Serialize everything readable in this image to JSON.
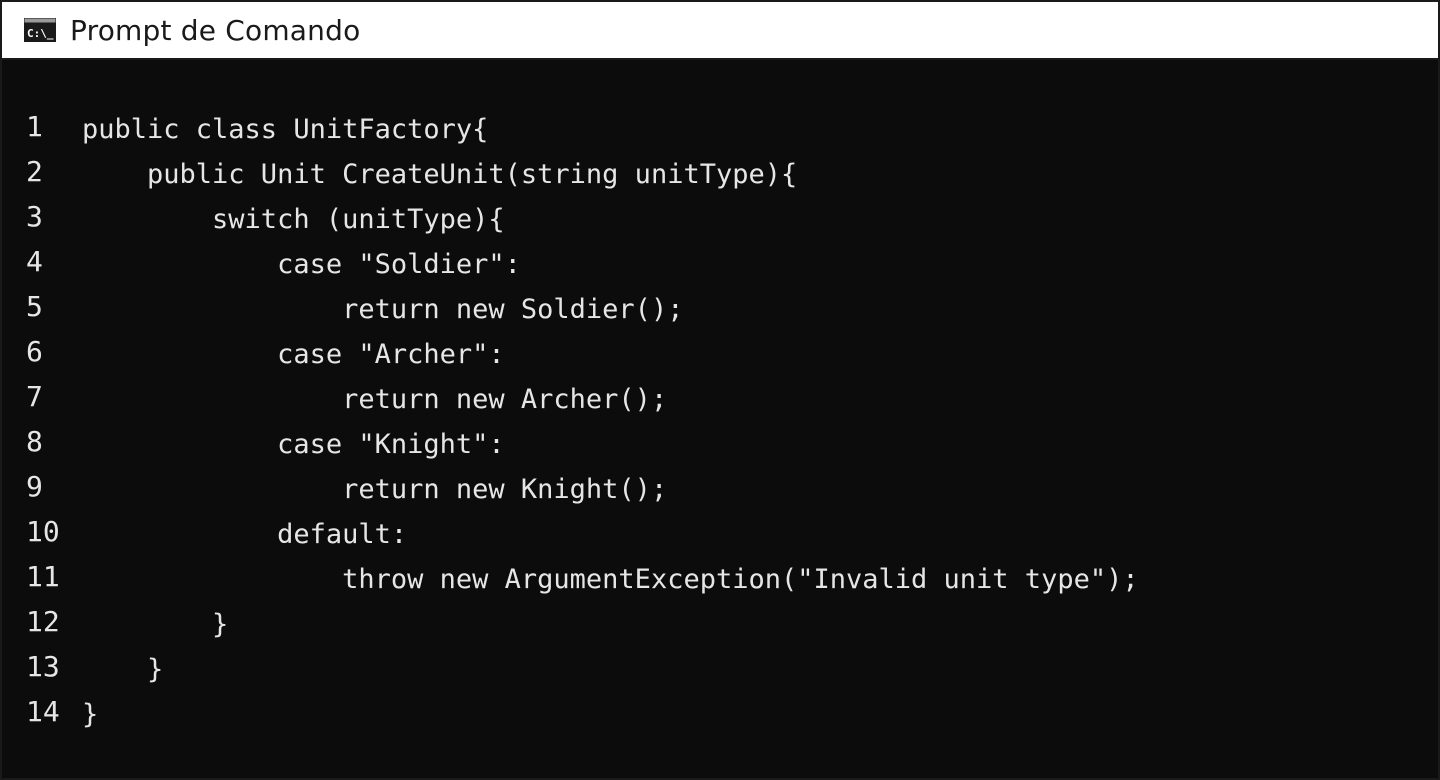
{
  "window": {
    "title": "Prompt de Comando",
    "icon": "command-prompt-icon"
  },
  "console": {
    "lines": [
      {
        "n": "1",
        "text": "public class UnitFactory{"
      },
      {
        "n": "2",
        "text": "    public Unit CreateUnit(string unitType){"
      },
      {
        "n": "3",
        "text": "        switch (unitType){"
      },
      {
        "n": "4",
        "text": "            case \"Soldier\":"
      },
      {
        "n": "5",
        "text": "                return new Soldier();"
      },
      {
        "n": "6",
        "text": "            case \"Archer\":"
      },
      {
        "n": "7",
        "text": "                return new Archer();"
      },
      {
        "n": "8",
        "text": "            case \"Knight\":"
      },
      {
        "n": "9",
        "text": "                return new Knight();"
      },
      {
        "n": "10",
        "text": "            default:"
      },
      {
        "n": "11",
        "text": "                throw new ArgumentException(\"Invalid unit type\");"
      },
      {
        "n": "12",
        "text": "        }"
      },
      {
        "n": "13",
        "text": "    }"
      },
      {
        "n": "14",
        "text": "}"
      }
    ]
  },
  "colors": {
    "background": "#0c0c0c",
    "text": "#e6e6e6",
    "titlebar": "#ffffff"
  }
}
